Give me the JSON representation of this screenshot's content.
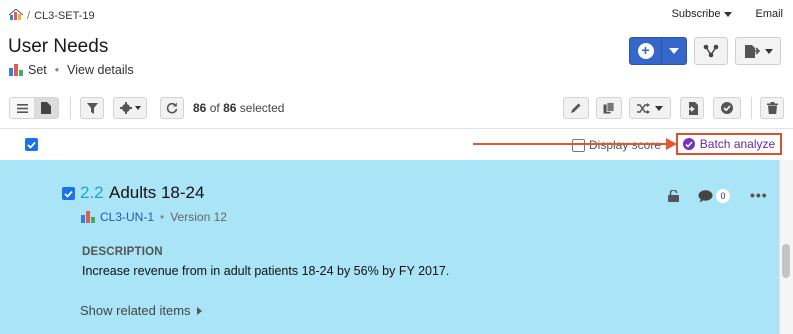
{
  "breadcrumb": {
    "item": "CL3-SET-19"
  },
  "header": {
    "subscribe_label": "Subscribe",
    "email_label": "Email",
    "title": "User Needs",
    "type_label": "Set",
    "view_details_label": "View details"
  },
  "toolbar": {
    "selected_count": "86",
    "of_label": "of",
    "total_count": "86",
    "selected_label": "selected"
  },
  "select_row": {
    "display_score_label": "Display score",
    "batch_analyze_label": "Batch analyze"
  },
  "item": {
    "number": "2.2",
    "title": "Adults 18-24",
    "id": "CL3-UN-1",
    "version": "Version 12",
    "comment_count": "0",
    "description_label": "DESCRIPTION",
    "description": "Increase revenue from in adult patients 18-24 by 56% by FY 2017.",
    "show_related_label": "Show related items"
  },
  "colors": {
    "accent_blue": "#3467c9",
    "panel_bg": "#a9e4f7",
    "item_number": "#1ea7c9",
    "annotation_arrow": "#e0592f",
    "batch_icon": "#7b2fbe"
  },
  "icons": [
    "home-icon",
    "set-icon",
    "plus-icon",
    "relations-icon",
    "export-icon",
    "list-view-icon",
    "document-view-icon",
    "filter-icon",
    "gear-icon",
    "refresh-icon",
    "edit-icon",
    "copy-icon",
    "shuffle-icon",
    "import-icon",
    "approve-icon",
    "trash-icon",
    "lock-icon",
    "comment-icon",
    "more-icon"
  ]
}
